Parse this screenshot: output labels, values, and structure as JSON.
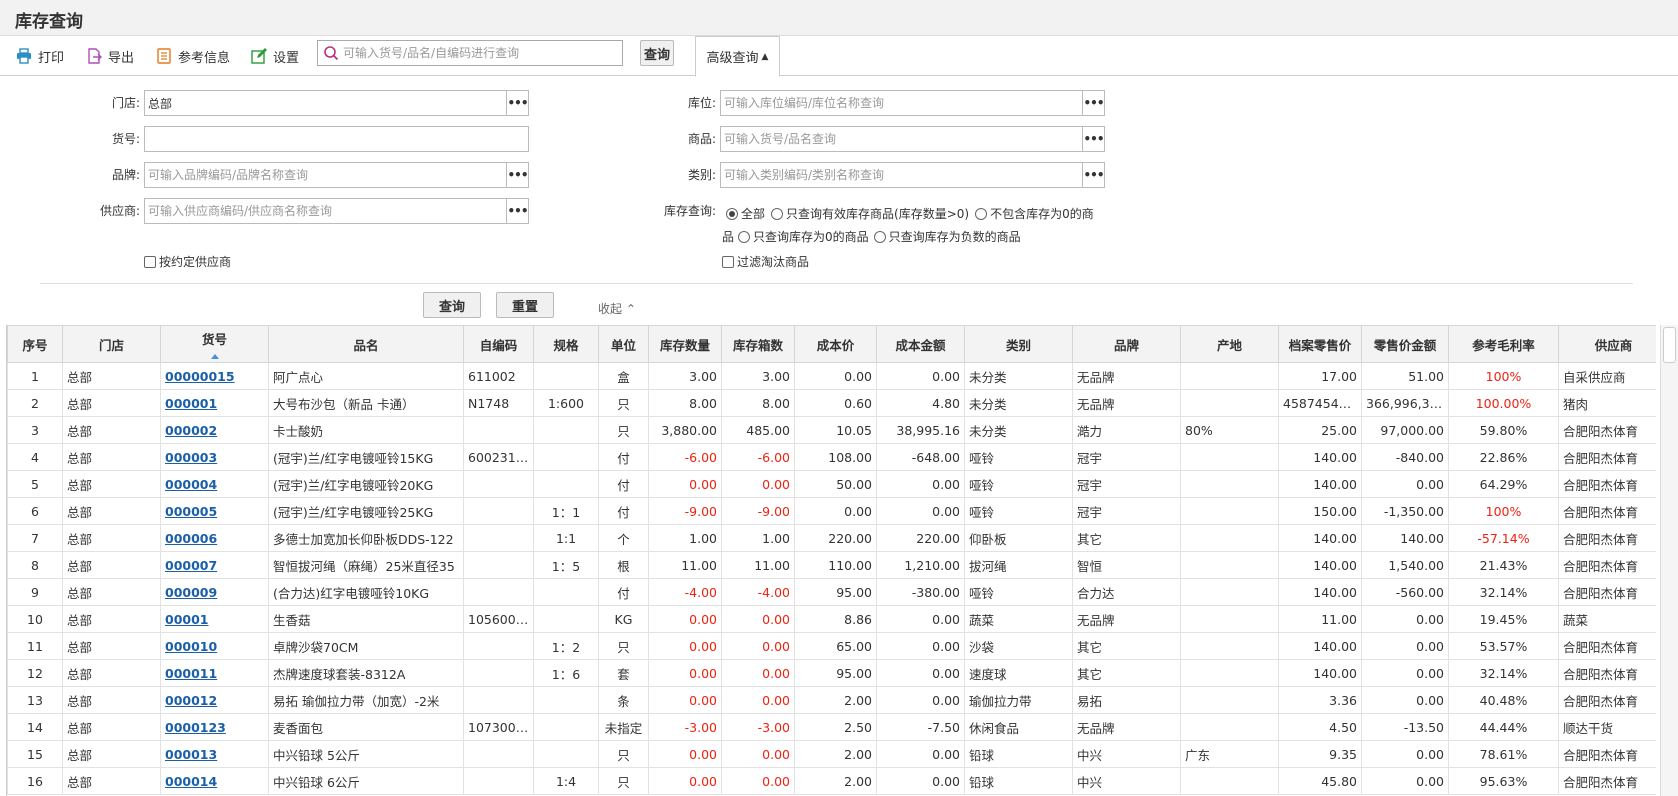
{
  "page": {
    "title": "库存查询"
  },
  "toolbar": {
    "print_label": "打印",
    "export_label": "导出",
    "reference_label": "参考信息",
    "settings_label": "设置",
    "search_placeholder": "可输入货号/品名/自编码进行查询",
    "query_label": "查询",
    "advanced_label": "高级查询"
  },
  "form": {
    "store_label": "门店:",
    "store_value": "总部",
    "location_label": "库位:",
    "location_placeholder": "可输入库位编码/库位名称查询",
    "code_label": "货号:",
    "code_value": "",
    "goods_label": "商品:",
    "goods_placeholder": "可输入货号/品名查询",
    "brand_label": "品牌:",
    "brand_placeholder": "可输入品牌编码/品牌名称查询",
    "category_label": "类别:",
    "category_placeholder": "可输入类别编码/类别名称查询",
    "supplier_label": "供应商:",
    "supplier_placeholder": "可输入供应商编码/供应商名称查询",
    "stock_query_label": "库存查询:",
    "radio_all": "全部",
    "radio_valid": "只查询有效库存商品(库存数量>0)",
    "radio_nonzero_a": "不包含库存为0的商",
    "radio_nonzero_b": "品",
    "radio_zero": "只查询库存为0的商品",
    "radio_negative": "只查询库存为负数的商品",
    "by_supplier_label": "按约定供应商",
    "filter_obsolete_label": "过滤淘汰商品",
    "query_btn": "查询",
    "reset_btn": "重置",
    "collapse_label": "收起"
  },
  "table": {
    "headers": [
      "序号",
      "门店",
      "货号",
      "品名",
      "自编码",
      "规格",
      "单位",
      "库存数量",
      "库存箱数",
      "成本价",
      "成本金额",
      "类别",
      "品牌",
      "产地",
      "档案零售价",
      "零售价金额",
      "参考毛利率",
      "供应商"
    ],
    "rows": [
      [
        "1",
        "总部",
        "00000015",
        "阿广点心",
        "611002",
        "",
        "盒",
        "3.00",
        "3.00",
        "0.00",
        "0.00",
        "未分类",
        "无品牌",
        "",
        "17.00",
        "51.00",
        "100%",
        "自采供应商"
      ],
      [
        "2",
        "总部",
        "000001",
        "大号布沙包（新品 卡通）",
        "N1748",
        "1:600",
        "只",
        "8.00",
        "8.00",
        "0.60",
        "4.80",
        "未分类",
        "无品牌",
        "",
        "45874543.00",
        "366,996,344...",
        "100.00%",
        "猪肉"
      ],
      [
        "3",
        "总部",
        "000002",
        "卡士酸奶",
        "",
        "",
        "只",
        "3,880.00",
        "485.00",
        "10.05",
        "38,995.16",
        "未分类",
        "澔力",
        "80%",
        "25.00",
        "97,000.00",
        "59.80%",
        "合肥阳杰体育"
      ],
      [
        "4",
        "总部",
        "000003",
        "(冠宇)兰/红字电镀哑铃15KG",
        "60023178",
        "",
        "付",
        "-6.00",
        "-6.00",
        "108.00",
        "-648.00",
        "哑铃",
        "冠宇",
        "",
        "140.00",
        "-840.00",
        "22.86%",
        "合肥阳杰体育"
      ],
      [
        "5",
        "总部",
        "000004",
        "(冠宇)兰/红字电镀哑铃20KG",
        "",
        "",
        "付",
        "0.00",
        "0.00",
        "50.00",
        "0.00",
        "哑铃",
        "冠宇",
        "",
        "140.00",
        "0.00",
        "64.29%",
        "合肥阳杰体育"
      ],
      [
        "6",
        "总部",
        "000005",
        "(冠宇)兰/红字电镀哑铃25KG",
        "",
        "1：1",
        "付",
        "-9.00",
        "-9.00",
        "0.00",
        "0.00",
        "哑铃",
        "冠宇",
        "",
        "150.00",
        "-1,350.00",
        "100%",
        "合肥阳杰体育"
      ],
      [
        "7",
        "总部",
        "000006",
        "多德士加宽加长仰卧板DDS-122",
        "",
        "1:1",
        "个",
        "1.00",
        "1.00",
        "220.00",
        "220.00",
        "仰卧板",
        "其它",
        "",
        "140.00",
        "140.00",
        "-57.14%",
        "合肥阳杰体育"
      ],
      [
        "8",
        "总部",
        "000007",
        "智恒拔河绳（麻绳）25米直径35",
        "",
        "1：5",
        "根",
        "11.00",
        "11.00",
        "110.00",
        "1,210.00",
        "拔河绳",
        "智恒",
        "",
        "140.00",
        "1,540.00",
        "21.43%",
        "合肥阳杰体育"
      ],
      [
        "9",
        "总部",
        "000009",
        "(合力达)红字电镀哑铃10KG",
        "",
        "",
        "付",
        "-4.00",
        "-4.00",
        "95.00",
        "-380.00",
        "哑铃",
        "合力达",
        "",
        "140.00",
        "-560.00",
        "32.14%",
        "合肥阳杰体育"
      ],
      [
        "10",
        "总部",
        "00001",
        "生香菇",
        "10560001",
        "",
        "KG",
        "0.00",
        "0.00",
        "8.86",
        "0.00",
        "蔬菜",
        "无品牌",
        "",
        "11.00",
        "0.00",
        "19.45%",
        "蔬菜"
      ],
      [
        "11",
        "总部",
        "000010",
        "卓牌沙袋70CM",
        "",
        "1：2",
        "只",
        "0.00",
        "0.00",
        "65.00",
        "0.00",
        "沙袋",
        "其它",
        "",
        "140.00",
        "0.00",
        "53.57%",
        "合肥阳杰体育"
      ],
      [
        "12",
        "总部",
        "000011",
        "杰牌速度球套装-8312A",
        "",
        "1：6",
        "套",
        "0.00",
        "0.00",
        "95.00",
        "0.00",
        "速度球",
        "其它",
        "",
        "140.00",
        "0.00",
        "32.14%",
        "合肥阳杰体育"
      ],
      [
        "13",
        "总部",
        "000012",
        "易拓 瑜伽拉力带（加宽）-2米",
        "",
        "",
        "条",
        "0.00",
        "0.00",
        "2.00",
        "0.00",
        "瑜伽拉力带",
        "易拓",
        "",
        "3.36",
        "0.00",
        "40.48%",
        "合肥阳杰体育"
      ],
      [
        "14",
        "总部",
        "0000123",
        "麦香面包",
        "10730002",
        "",
        "未指定",
        "-3.00",
        "-3.00",
        "2.50",
        "-7.50",
        "休闲食品",
        "无品牌",
        "",
        "4.50",
        "-13.50",
        "44.44%",
        "顺达干货"
      ],
      [
        "15",
        "总部",
        "000013",
        "中兴铅球 5公斤",
        "",
        "",
        "只",
        "0.00",
        "0.00",
        "2.00",
        "0.00",
        "铅球",
        "中兴",
        "广东",
        "9.35",
        "0.00",
        "78.61%",
        "合肥阳杰体育"
      ],
      [
        "16",
        "总部",
        "000014",
        "中兴铅球 6公斤",
        "",
        "1:4",
        "只",
        "0.00",
        "0.00",
        "2.00",
        "0.00",
        "铅球",
        "中兴",
        "",
        "45.80",
        "0.00",
        "95.63%",
        "合肥阳杰体育"
      ]
    ],
    "red_cells": {
      "1": [
        16
      ],
      "2": [
        16
      ],
      "4": [
        7,
        8
      ],
      "5": [
        7,
        8
      ],
      "6": [
        7,
        8,
        16
      ],
      "7": [
        16
      ],
      "9": [
        7,
        8
      ],
      "10": [
        7,
        8
      ],
      "11": [
        7,
        8
      ],
      "12": [
        7,
        8
      ],
      "13": [
        7,
        8
      ],
      "14": [
        7,
        8
      ],
      "15": [
        7,
        8
      ],
      "16": [
        7,
        8
      ]
    }
  },
  "colors": {
    "accent": "#1a5fa8",
    "negative": "#e21",
    "header_bg": "#f3f3f3"
  }
}
